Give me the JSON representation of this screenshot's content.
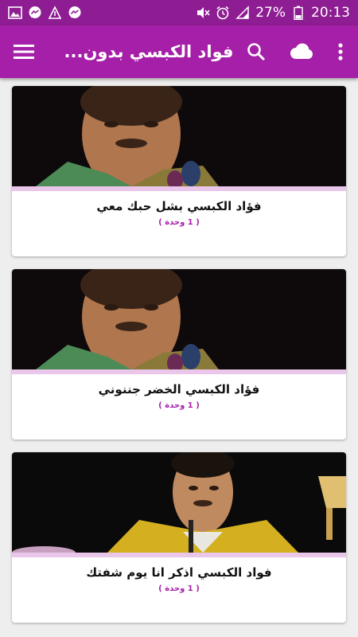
{
  "status_bar": {
    "battery": "27%",
    "time": "20:13"
  },
  "app_bar": {
    "title": "فواد الكبسي بدون..."
  },
  "items": [
    {
      "title": "فؤاد الكبسي بشل حبك معي",
      "subtitle": "( 1 وحدة )"
    },
    {
      "title": "فؤاد الكبسي الخضر جننوني",
      "subtitle": "( 1 وحدة )"
    },
    {
      "title": "فواد الكبسي اذكر انا يوم شفتك",
      "subtitle": "( 1 وحدة )"
    }
  ],
  "colors": {
    "status_bar": "#8e1c92",
    "app_bar": "#a51fa8",
    "accent_strip": "#e9c6ea",
    "subtitle": "#a51fa8"
  }
}
